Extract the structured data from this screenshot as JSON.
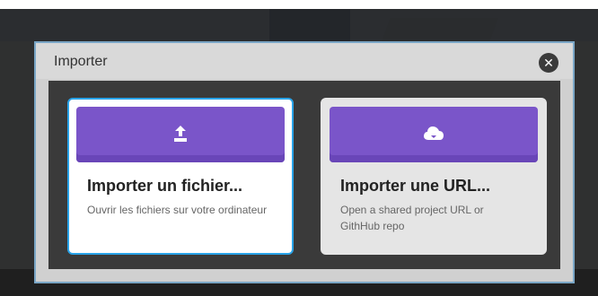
{
  "dialog": {
    "title": "Importer",
    "close_icon": "close-icon"
  },
  "cards": [
    {
      "title": "Importer un fichier...",
      "description": "Ouvrir les fichiers sur votre ordinateur",
      "icon": "upload-icon",
      "selected": true
    },
    {
      "title": "Importer une URL...",
      "description": "Open a shared project URL or GithHub repo",
      "icon": "cloud-download-icon",
      "selected": false
    }
  ],
  "colors": {
    "accent_purple": "#7a55c9",
    "selection_border": "#29a3e8"
  }
}
